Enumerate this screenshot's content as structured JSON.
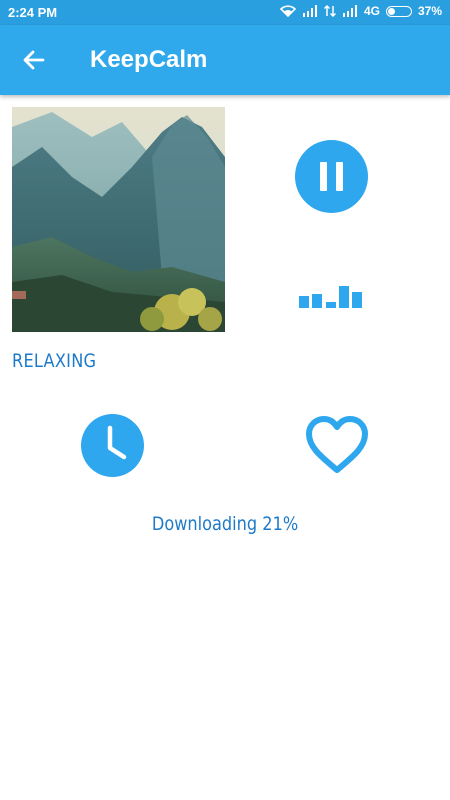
{
  "status_bar": {
    "time": "2:24 PM",
    "network": "4G",
    "battery_percent": "37%",
    "battery_level": 0.37
  },
  "app_bar": {
    "title": "KeepCalm",
    "back_icon": "arrow-left-icon"
  },
  "player": {
    "track_name": "RELAXING",
    "state": "playing",
    "pause_icon": "pause-icon",
    "equalizer_icon": "equalizer-icon",
    "timer_icon": "clock-icon",
    "favorite_icon": "heart-outline-icon",
    "accent_color": "#2ea7ee",
    "text_color": "#1e7ac8"
  },
  "download": {
    "status_text": "Downloading 21%",
    "progress": 0.21
  }
}
